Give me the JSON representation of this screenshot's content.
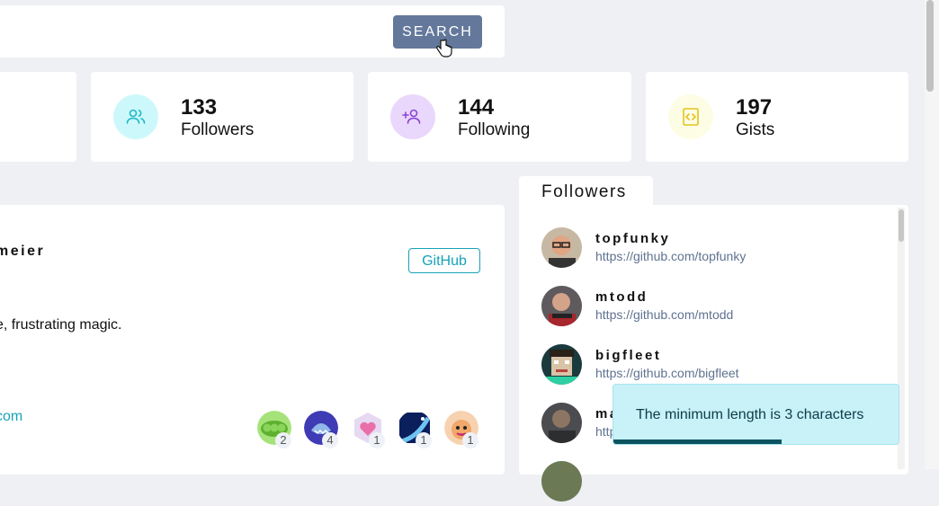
{
  "search": {
    "button_label": "SEARCH"
  },
  "stats": [
    {
      "value": "133",
      "label": "Followers",
      "icon": "users-icon",
      "bg": "#cdf8fb",
      "fg": "#20b8c8"
    },
    {
      "value": "144",
      "label": "Following",
      "icon": "user-plus-icon",
      "bg": "#e9d8fb",
      "fg": "#8a44d6"
    },
    {
      "value": "197",
      "label": "Gists",
      "icon": "code-icon",
      "bg": "#fdfde6",
      "fg": "#e5c318"
    }
  ],
  "user": {
    "name_fragment": "meier",
    "github_label": "GitHub",
    "bio_fragment": "e, frustrating magic.",
    "blog_fragment": "com",
    "orgs": [
      {
        "count": "2",
        "icon": "peas-org-icon",
        "color": "#7ccf3f"
      },
      {
        "count": "4",
        "icon": "shark-org-icon",
        "color": "#3e3bb5"
      },
      {
        "count": "1",
        "icon": "heart-org-icon",
        "color": "#e96fa8"
      },
      {
        "count": "1",
        "icon": "rocket-org-icon",
        "color": "#1f4aa8"
      },
      {
        "count": "1",
        "icon": "cat-org-icon",
        "color": "#f1a86a"
      }
    ]
  },
  "followers_panel": {
    "title": "Followers",
    "items": [
      {
        "login": "topfunky",
        "url": "https://github.com/topfunky"
      },
      {
        "login": "mtodd",
        "url": "https://github.com/mtodd"
      },
      {
        "login": "bigfleet",
        "url": "https://github.com/bigfleet"
      },
      {
        "login": "ma",
        "url": "http"
      }
    ]
  },
  "toast": {
    "message": "The minimum length is 3 characters",
    "progress": 0.59
  }
}
